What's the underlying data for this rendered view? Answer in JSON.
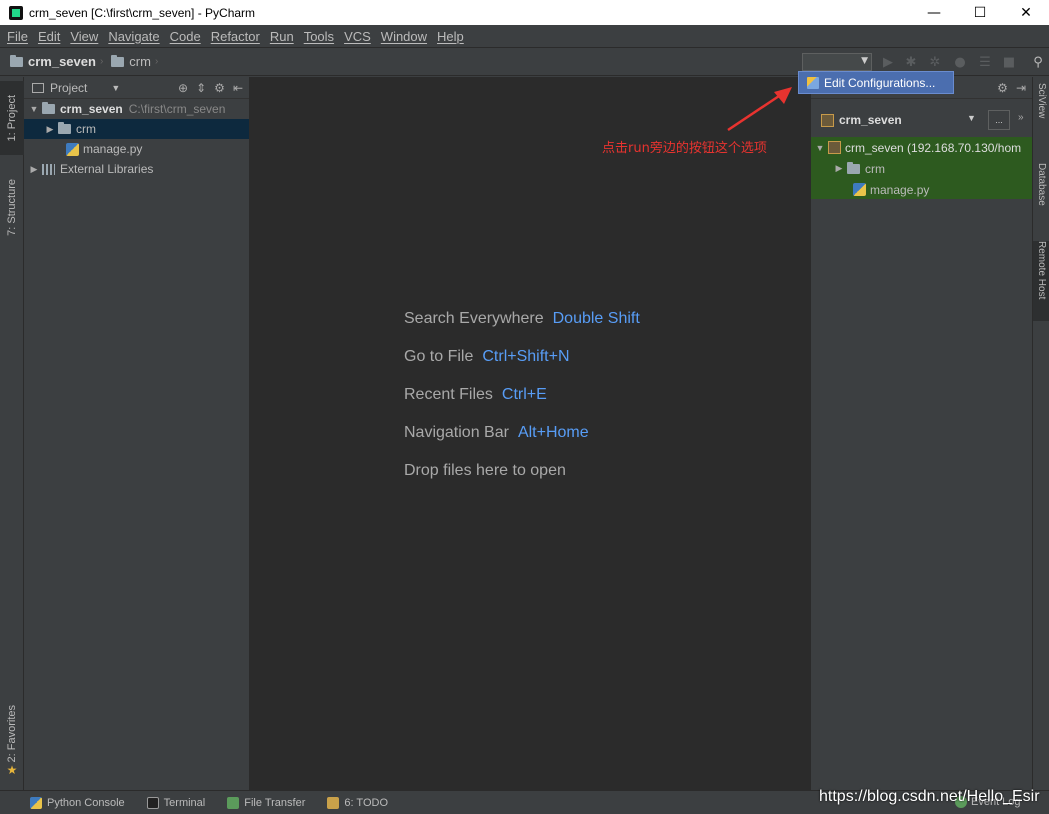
{
  "window": {
    "title": "crm_seven [C:\\first\\crm_seven] - PyCharm",
    "controls": {
      "minimize": "—",
      "maximize": "☐",
      "close": "✕"
    }
  },
  "menubar": {
    "items": [
      "File",
      "Edit",
      "View",
      "Navigate",
      "Code",
      "Refactor",
      "Run",
      "Tools",
      "VCS",
      "Window",
      "Help"
    ]
  },
  "navbar": {
    "breadcrumb": [
      {
        "label": "crm_seven",
        "icon": "folder-icon"
      },
      {
        "label": "crm",
        "icon": "folder-icon"
      }
    ]
  },
  "popup": {
    "edit_configurations": "Edit Configurations..."
  },
  "left_strip": {
    "project_tab": "1: Project",
    "structure_tab": "7: Structure",
    "favorites_tab": "2: Favorites"
  },
  "project_panel": {
    "header": "Project",
    "tree": [
      {
        "label": "crm_seven",
        "path": "C:\\first\\crm_seven"
      },
      {
        "label": "crm"
      },
      {
        "label": "manage.py"
      },
      {
        "label": "External Libraries"
      }
    ]
  },
  "editor": {
    "hints": [
      {
        "label": "Search Everywhere",
        "key": "Double Shift"
      },
      {
        "label": "Go to File",
        "key": "Ctrl+Shift+N"
      },
      {
        "label": "Recent Files",
        "key": "Ctrl+E"
      },
      {
        "label": "Navigation Bar",
        "key": "Alt+Home"
      },
      {
        "label": "Drop files here to open",
        "key": ""
      }
    ]
  },
  "remote_panel": {
    "server": "crm_seven",
    "more": "...",
    "tree": [
      {
        "label": "crm_seven (192.168.70.130/hom"
      },
      {
        "label": "crm"
      },
      {
        "label": "manage.py"
      }
    ]
  },
  "right_strip": {
    "sciview": "SciView",
    "database": "Database",
    "remote_host": "Remote Host"
  },
  "annotation": {
    "text": "点击run旁边的按钮这个选项",
    "color": "#e8332f"
  },
  "statusbar": {
    "items": [
      {
        "label": "Python Console",
        "icon": "python-console-icon"
      },
      {
        "label": "Terminal",
        "icon": "terminal-icon"
      },
      {
        "label": "File Transfer",
        "icon": "file-transfer-icon"
      },
      {
        "label": "6: TODO",
        "icon": "todo-icon"
      }
    ],
    "event_log": "Event Log"
  },
  "watermark": "https://blog.csdn.net/Hello_Esir",
  "colors": {
    "accent_key": "#589df6",
    "selection": "#0d293e",
    "remote_tree_bg": "#2d5a1f",
    "popup_bg": "#4b6eaf"
  }
}
